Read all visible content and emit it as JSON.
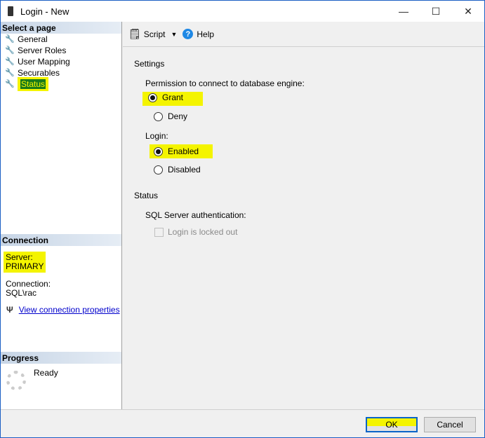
{
  "window": {
    "title": "Login - New",
    "minimize": "—",
    "maximize": "☐",
    "close": "✕"
  },
  "sidebar": {
    "header": "Select a page",
    "items": [
      {
        "label": "General"
      },
      {
        "label": "Server Roles"
      },
      {
        "label": "User Mapping"
      },
      {
        "label": "Securables"
      },
      {
        "label": "Status"
      }
    ]
  },
  "connection": {
    "header": "Connection",
    "server_label": "Server:",
    "server": "PRIMARY",
    "connection_label": "Connection:",
    "connection": "SQL\\rac",
    "link": "View connection properties"
  },
  "progress": {
    "header": "Progress",
    "status": "Ready"
  },
  "toolbar": {
    "script": "Script",
    "help": "Help"
  },
  "settings": {
    "heading": "Settings",
    "permission_label": "Permission to connect to database engine:",
    "grant": "Grant",
    "deny": "Deny",
    "login_label": "Login:",
    "enabled": "Enabled",
    "disabled": "Disabled"
  },
  "status": {
    "heading": "Status",
    "auth_label": "SQL Server authentication:",
    "locked": "Login is locked out"
  },
  "buttons": {
    "ok": "OK",
    "cancel": "Cancel"
  },
  "colors": {
    "highlight": "#f4f400",
    "border": "#1b5fc4"
  }
}
